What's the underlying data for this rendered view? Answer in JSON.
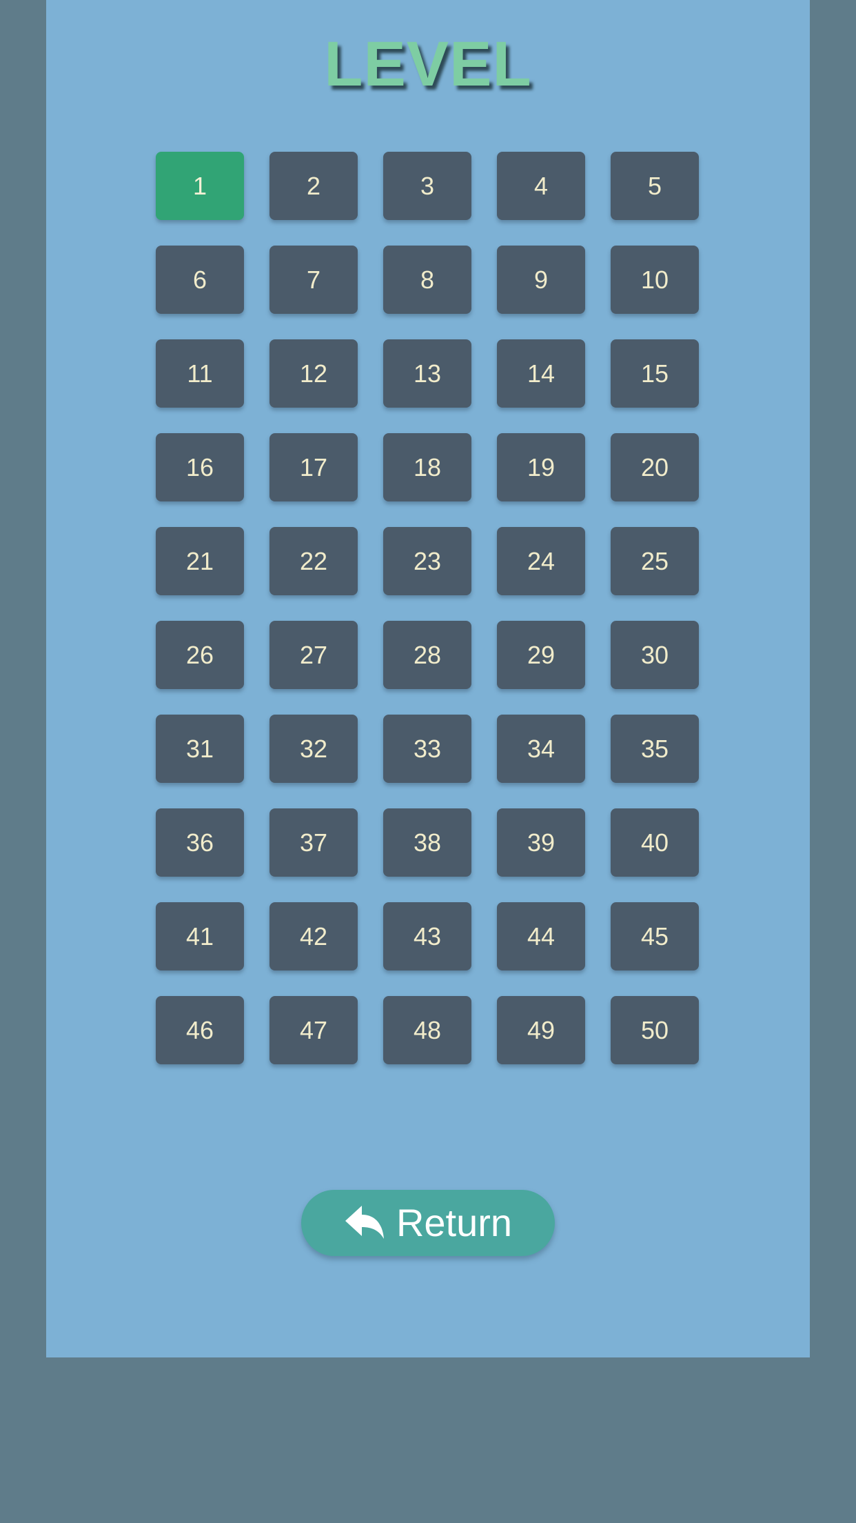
{
  "title": "LEVEL",
  "levels": [
    "1",
    "2",
    "3",
    "4",
    "5",
    "6",
    "7",
    "8",
    "9",
    "10",
    "11",
    "12",
    "13",
    "14",
    "15",
    "16",
    "17",
    "18",
    "19",
    "20",
    "21",
    "22",
    "23",
    "24",
    "25",
    "26",
    "27",
    "28",
    "29",
    "30",
    "31",
    "32",
    "33",
    "34",
    "35",
    "36",
    "37",
    "38",
    "39",
    "40",
    "41",
    "42",
    "43",
    "44",
    "45",
    "46",
    "47",
    "48",
    "49",
    "50"
  ],
  "selected_level": "1",
  "return_button": {
    "label": "Return",
    "icon": "reply-arrow-icon"
  },
  "colors": {
    "outer_background": "#5f7c8a",
    "panel_background": "#7db1d5",
    "title": "#7ecda3",
    "level_button": "#4b5b6a",
    "level_button_selected": "#31a475",
    "level_text": "#f1eccb",
    "return_button": "#4aa79f"
  }
}
